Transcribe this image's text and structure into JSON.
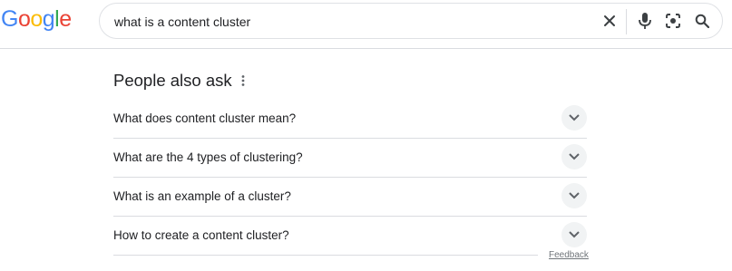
{
  "logo": {
    "letters": [
      "G",
      "o",
      "o",
      "g",
      "l",
      "e"
    ],
    "colors": [
      "#4285F4",
      "#EA4335",
      "#FBBC05",
      "#4285F4",
      "#34A853",
      "#EA4335"
    ]
  },
  "search": {
    "query": "what is a content cluster",
    "icons": [
      "clear-icon",
      "microphone-icon",
      "lens-icon",
      "search-icon"
    ]
  },
  "paa": {
    "title": "People also ask",
    "questions": [
      "What does content cluster mean?",
      "What are the 4 types of clustering?",
      "What is an example of a cluster?",
      "How to create a content cluster?"
    ]
  },
  "feedback_label": "Feedback"
}
